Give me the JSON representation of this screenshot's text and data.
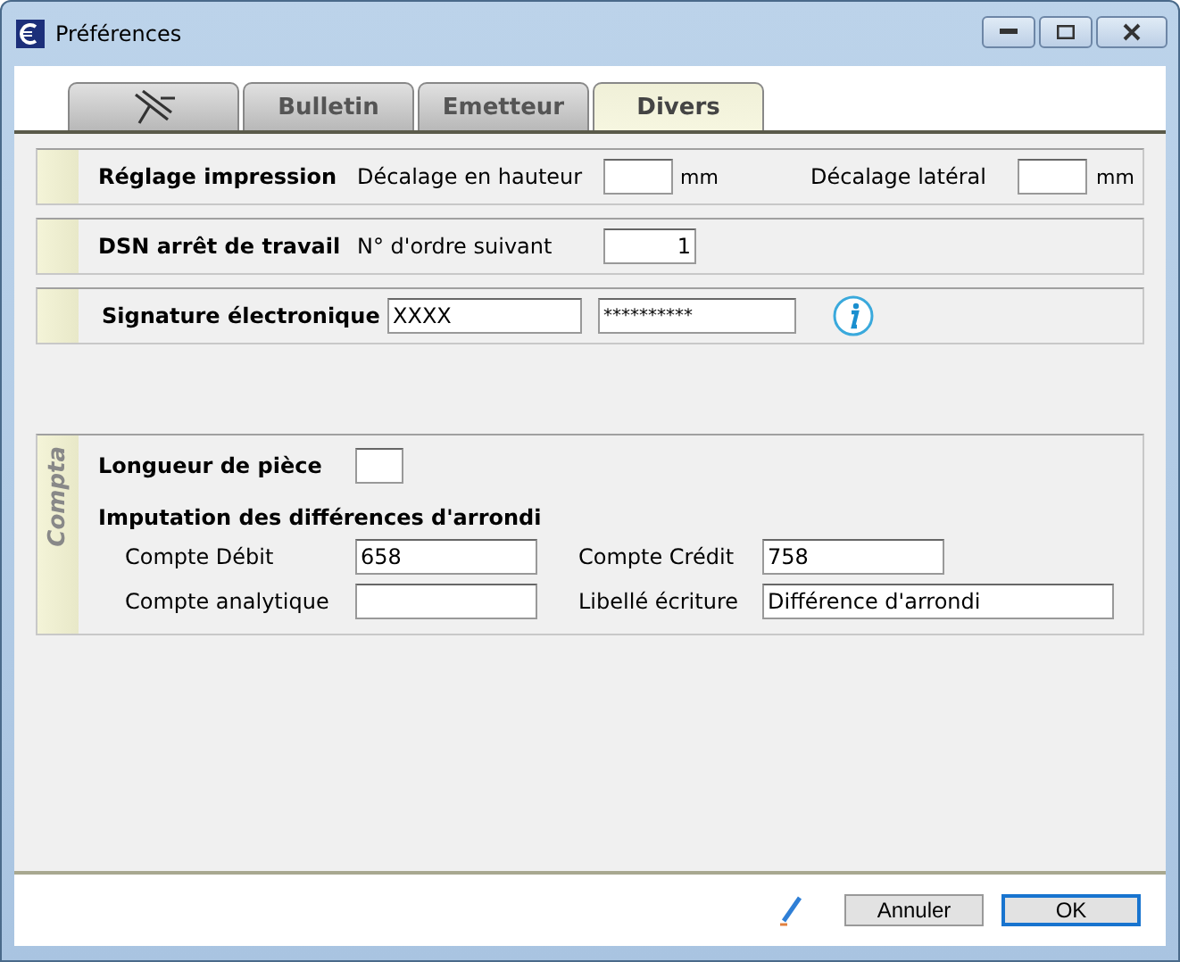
{
  "window": {
    "title": "Préférences"
  },
  "tabs": [
    {
      "kind": "icon",
      "selected": false
    },
    {
      "kind": "text",
      "label": "Bulletin",
      "selected": false
    },
    {
      "kind": "text",
      "label": "Emetteur",
      "selected": false
    },
    {
      "kind": "text",
      "label": "Divers",
      "selected": true
    }
  ],
  "print_settings": {
    "title": "Réglage impression",
    "vertical_offset": {
      "label": "Décalage en hauteur",
      "unit": "mm"
    },
    "lateral_offset": {
      "label": "Décalage latéral",
      "unit": "mm"
    }
  },
  "dsn": {
    "title": "DSN arrêt de travail",
    "label": "N° d'ordre suivant",
    "value": "1"
  },
  "signature": {
    "title": "Signature électronique",
    "login": "XXXX",
    "password": "**********"
  },
  "compta": {
    "side_label": "Compta",
    "piece_length": {
      "label": "Longueur de pièce"
    },
    "rounding_title": "Imputation des différences d'arrondi",
    "fields": [
      {
        "label": "Compte Débit",
        "value": "658"
      },
      {
        "label": "Compte Crédit",
        "value": "758"
      },
      {
        "label": "Compte analytique"
      },
      {
        "label": "Libellé écriture",
        "value": "Différence d'arrondi"
      }
    ]
  },
  "buttons": [
    {
      "label": "Annuler",
      "default": false
    },
    {
      "label": "OK",
      "default": true
    }
  ]
}
